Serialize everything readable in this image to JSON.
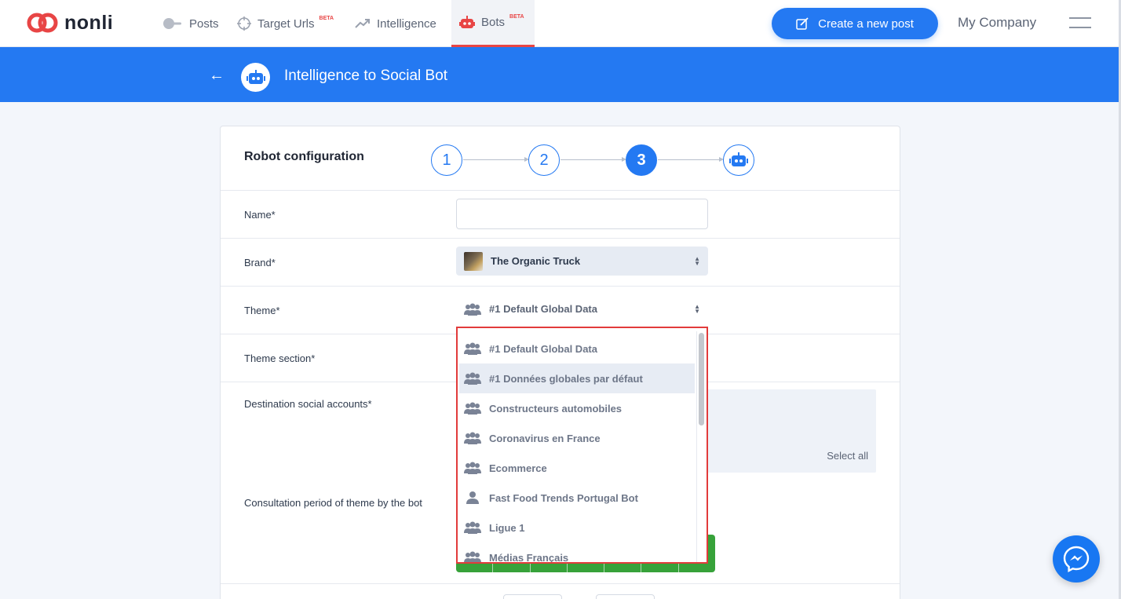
{
  "app": {
    "logo_text": "nonli",
    "brand_color": "#e84545",
    "accent_color": "#2479f2"
  },
  "nav": {
    "items": [
      {
        "label": "Posts",
        "icon": "posts-icon",
        "beta": ""
      },
      {
        "label": "Target Urls",
        "icon": "target-icon",
        "beta": "BETA"
      },
      {
        "label": "Intelligence",
        "icon": "trend-icon",
        "beta": ""
      },
      {
        "label": "Bots",
        "icon": "robot-icon",
        "beta": "BETA",
        "active": true
      }
    ],
    "create_button": "Create a new post",
    "company": "My Company"
  },
  "banner": {
    "title": "Intelligence to Social Bot"
  },
  "card": {
    "title": "Robot configuration",
    "steps": [
      "1",
      "2",
      "3"
    ],
    "active_step": "3",
    "fields": {
      "name_label": "Name*",
      "name_value": "",
      "brand_label": "Brand*",
      "brand_value": "The Organic Truck",
      "theme_label": "Theme*",
      "theme_value": "#1 Default Global Data",
      "theme_section_label": "Theme section*",
      "destination_label": "Destination social accounts*",
      "select_all": "Select all",
      "consultation_label": "Consultation period of theme by the bot"
    }
  },
  "dropdown": {
    "options": [
      {
        "label": "#1 Default Global Data",
        "icon": "group-icon"
      },
      {
        "label": "#1 Données globales par défaut",
        "icon": "group-icon",
        "hover": true
      },
      {
        "label": "Constructeurs automobiles",
        "icon": "group-icon"
      },
      {
        "label": "Coronavirus en France",
        "icon": "group-icon"
      },
      {
        "label": "Ecommerce",
        "icon": "group-icon"
      },
      {
        "label": "Fast Food Trends Portugal Bot",
        "icon": "user-icon"
      },
      {
        "label": "Ligue 1",
        "icon": "group-icon"
      },
      {
        "label": "Médias Français",
        "icon": "group-icon"
      }
    ]
  }
}
